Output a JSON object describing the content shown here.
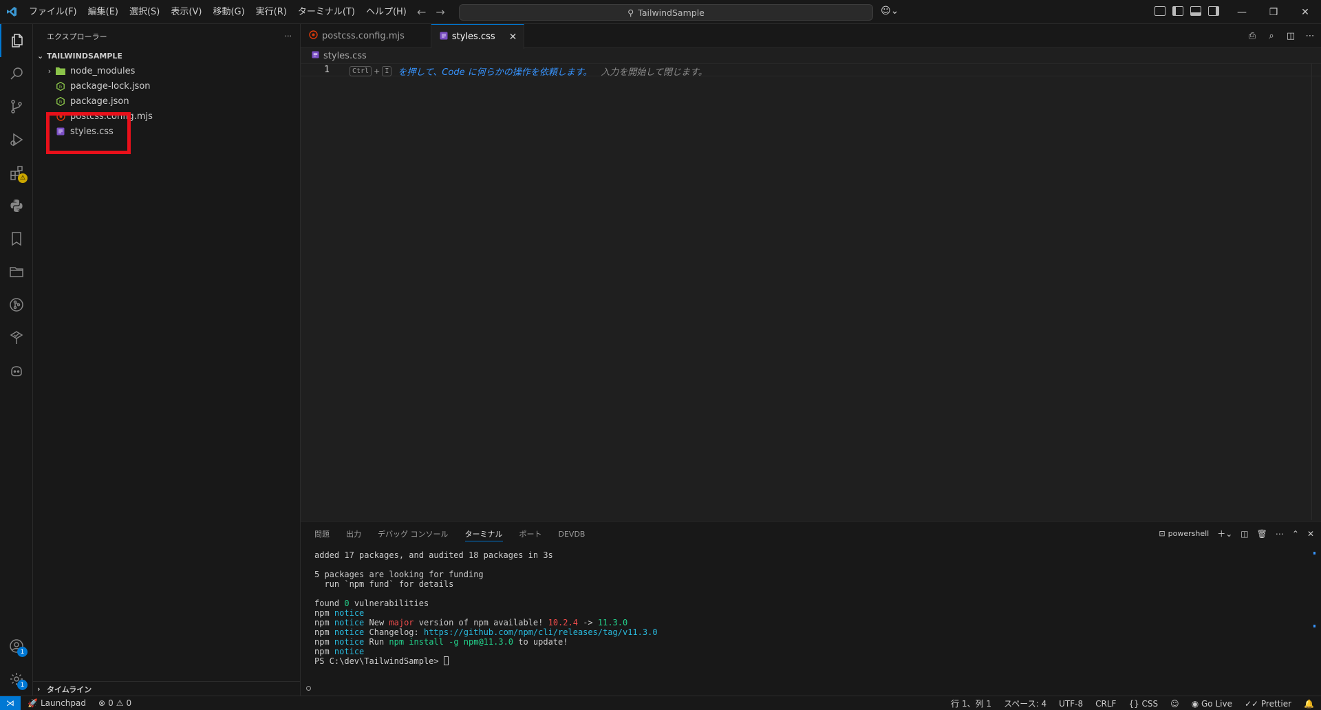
{
  "titlebar": {
    "menu": [
      "ファイル(F)",
      "編集(E)",
      "選択(S)",
      "表示(V)",
      "移動(G)",
      "実行(R)",
      "ターミナル(T)",
      "ヘルプ(H)"
    ],
    "search_text": "TailwindSample"
  },
  "activity": {
    "extensions_badge": "⚠",
    "accounts_badge": "1",
    "manage_badge": "1"
  },
  "sidebar": {
    "title": "エクスプローラー",
    "more": "···",
    "project": "TAILWINDSAMPLE",
    "items": [
      {
        "label": "node_modules",
        "kind": "folder"
      },
      {
        "label": "package-lock.json",
        "kind": "json"
      },
      {
        "label": "package.json",
        "kind": "json"
      },
      {
        "label": "postcss.config.mjs",
        "kind": "mjs"
      },
      {
        "label": "styles.css",
        "kind": "css"
      }
    ],
    "timeline": "タイムライン"
  },
  "editor": {
    "tabs": [
      {
        "label": "postcss.config.mjs",
        "active": false
      },
      {
        "label": "styles.css",
        "active": true
      }
    ],
    "breadcrumb": "styles.css",
    "line_number": "1",
    "hint_key1": "Ctrl",
    "hint_plus": "+",
    "hint_key2": "I",
    "hint_main": "を押して、Code に何らかの操作を依頼します。",
    "hint_sub": "入力を開始して閉じます。"
  },
  "panel": {
    "tabs": [
      "問題",
      "出力",
      "デバッグ コンソール",
      "ターミナル",
      "ポート",
      "DEVDB"
    ],
    "active_tab": "ターミナル",
    "shell": "powershell",
    "terminal": {
      "l1": "added 17 packages, and audited 18 packages in 3s",
      "l2": "5 packages are looking for funding",
      "l3": "  run `npm fund` for details",
      "l4a": "found ",
      "l4b": "0",
      "l4c": " vulnerabilities",
      "npm": "npm",
      "notice": "notice",
      "l6a": " New ",
      "l6b": "major",
      "l6c": " version of npm available! ",
      "l6d": "10.2.4",
      "l6e": " -> ",
      "l6f": "11.3.0",
      "l7a": " Changelog: ",
      "l7b": "https://github.com/npm/cli/releases/tag/v11.3.0",
      "l8a": " Run ",
      "l8b": "npm install -g npm@11.3.0",
      "l8c": " to update!",
      "prompt": "PS C:\\dev\\TailwindSample> "
    }
  },
  "statusbar": {
    "launchpad": "Launchpad",
    "errors": "0",
    "warnings": "0",
    "position": "行 1、列 1",
    "spaces": "スペース: 4",
    "encoding": "UTF-8",
    "eol": "CRLF",
    "language": "CSS",
    "golive": "Go Live",
    "prettier": "Prettier"
  },
  "colors": {
    "accent": "#0078d4",
    "highlight_box": "#e8101a",
    "hint_text": "#3794ff"
  }
}
